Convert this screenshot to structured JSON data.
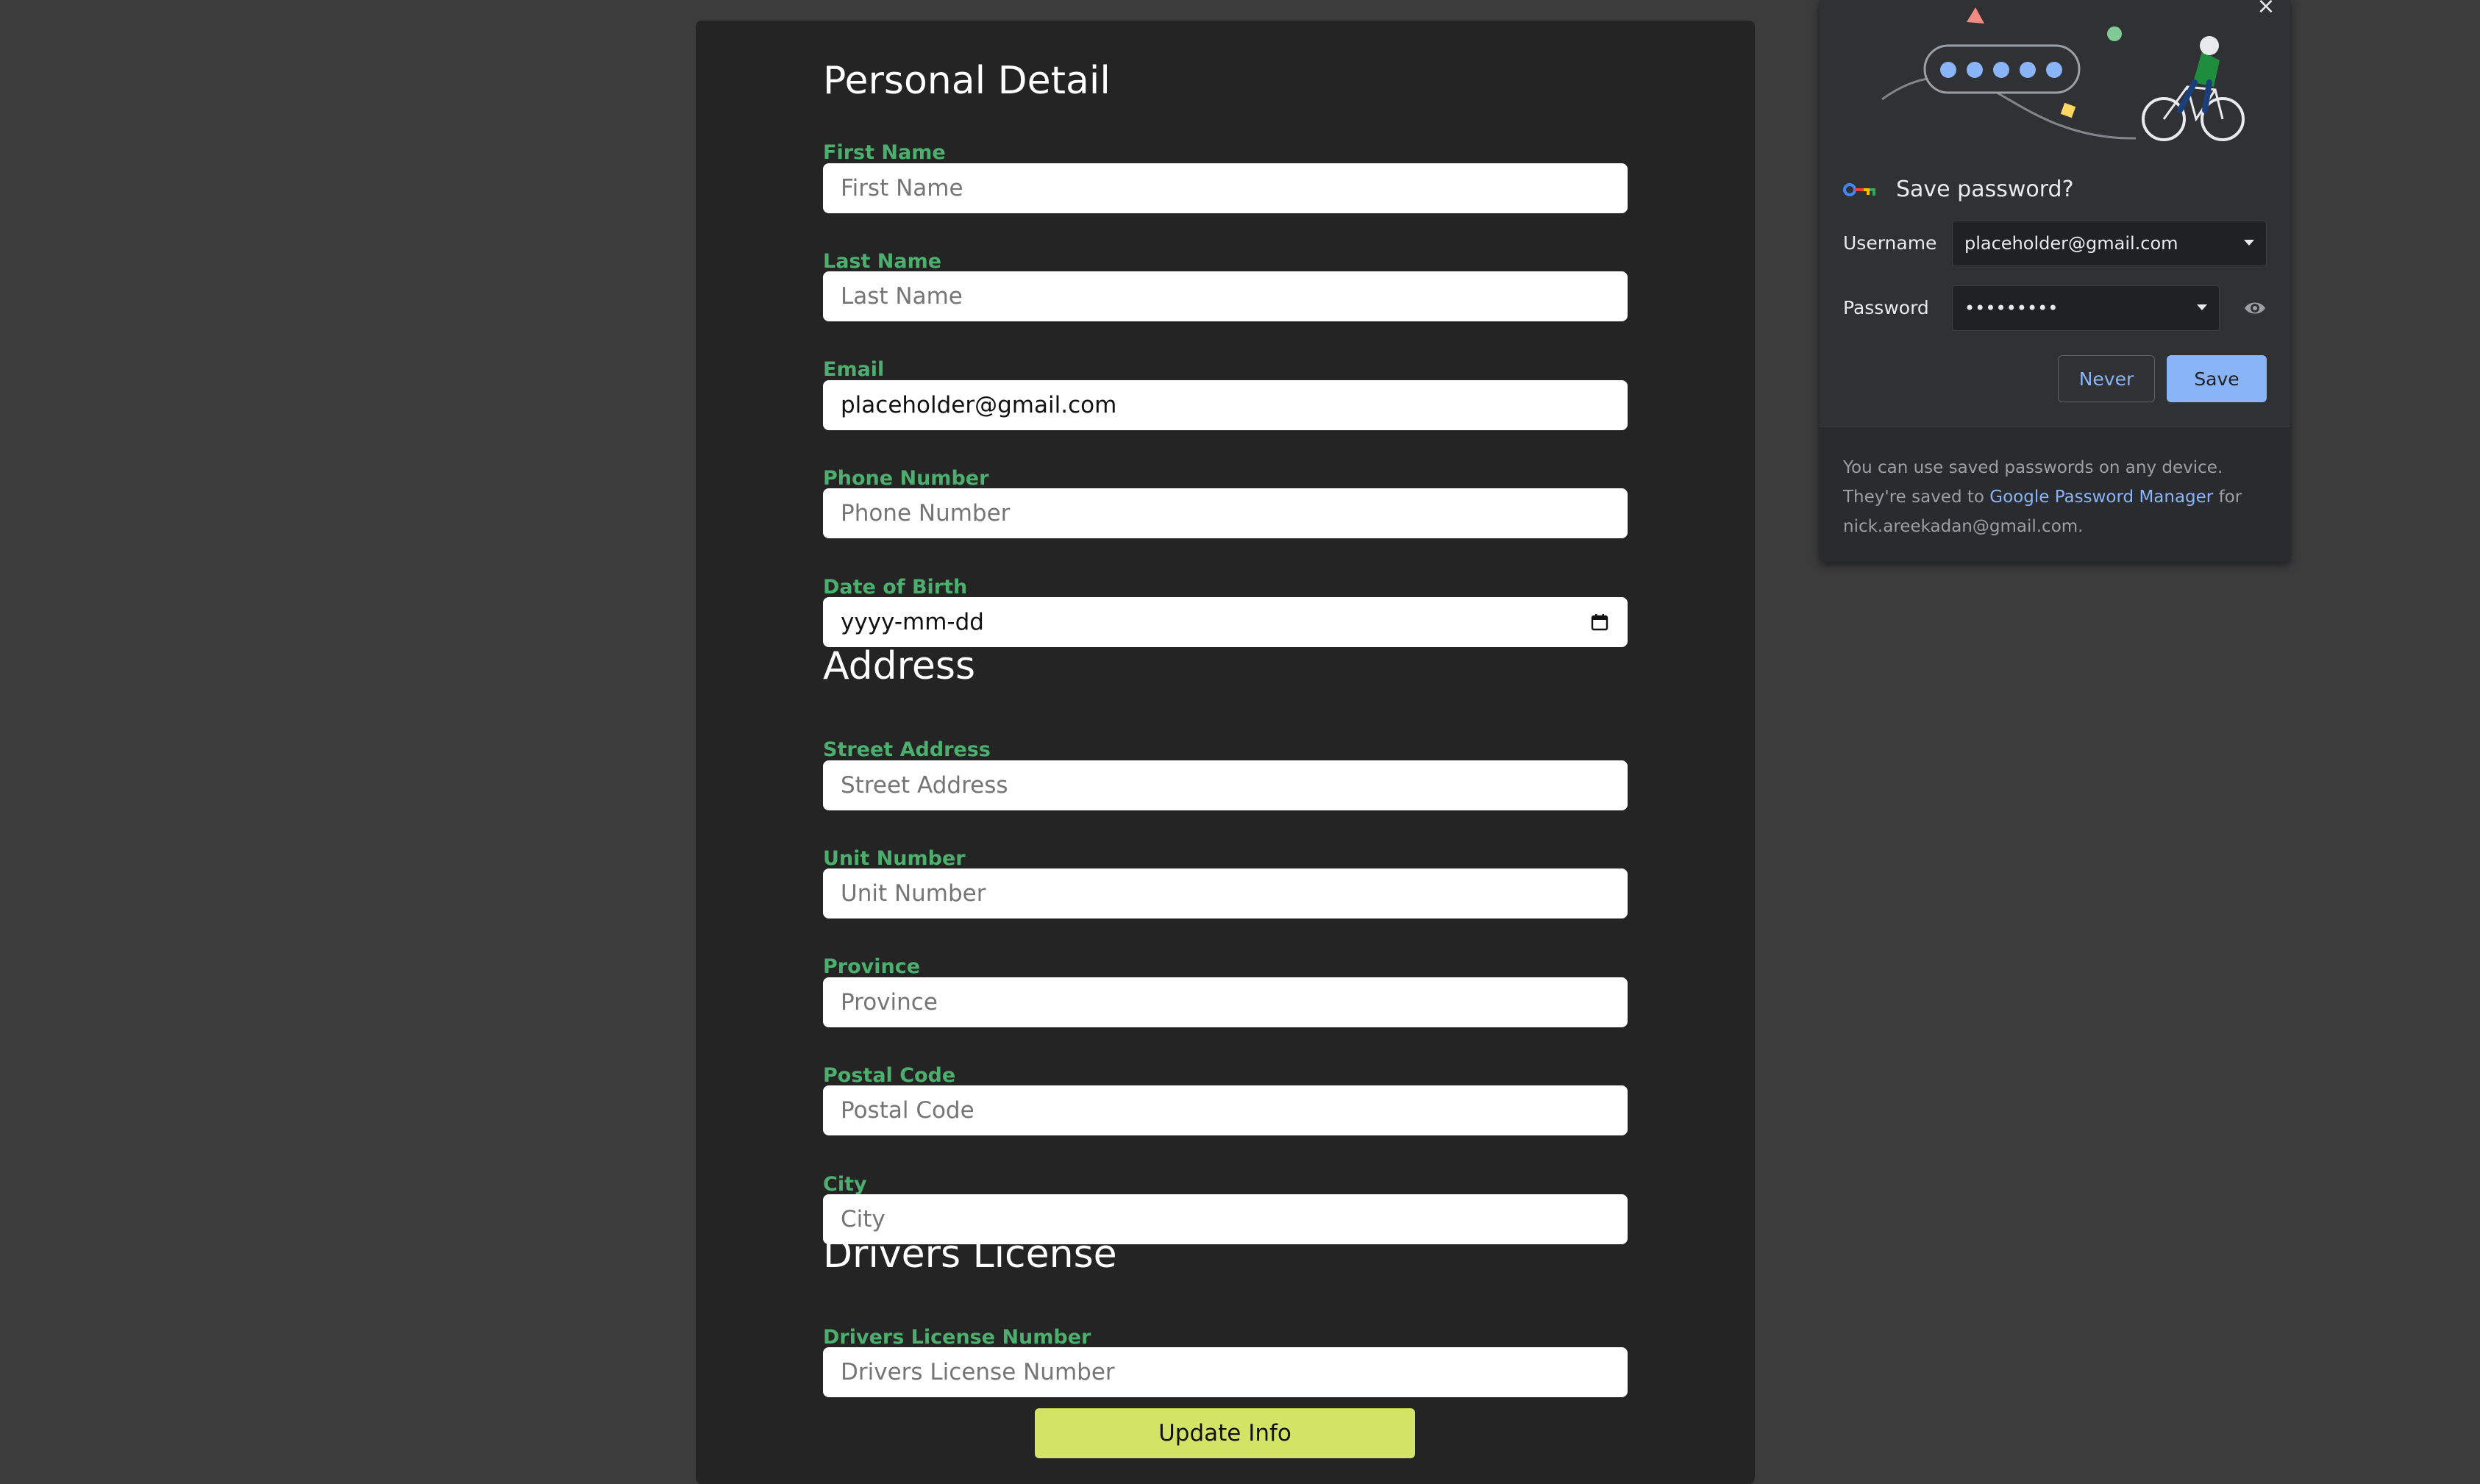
{
  "form": {
    "personal_title": "Personal Detail",
    "first_name": {
      "label": "First Name",
      "placeholder": "First Name"
    },
    "last_name": {
      "label": "Last Name",
      "placeholder": "Last Name"
    },
    "email": {
      "label": "Email",
      "value": "placeholder@gmail.com"
    },
    "phone": {
      "label": "Phone Number",
      "placeholder": "Phone Number"
    },
    "dob": {
      "label": "Date of Birth",
      "value": "yyyy-mm-dd"
    },
    "address_title": "Address",
    "street": {
      "label": "Street Address",
      "placeholder": "Street Address"
    },
    "unit": {
      "label": "Unit Number",
      "placeholder": "Unit Number"
    },
    "province": {
      "label": "Province",
      "placeholder": "Province"
    },
    "postal": {
      "label": "Postal Code",
      "placeholder": "Postal Code"
    },
    "city": {
      "label": "City",
      "placeholder": "City"
    },
    "license_title": "Drivers License",
    "license": {
      "label": "Drivers License Number",
      "placeholder": "Drivers License Number"
    },
    "submit_label": "Update Info"
  },
  "password_popup": {
    "title": "Save password?",
    "username_label": "Username",
    "username_value": "placeholder@gmail.com",
    "password_label": "Password",
    "password_value": "•••••••••",
    "never_label": "Never",
    "save_label": "Save",
    "footer_text_1": "You can use saved passwords on any device. They're saved to ",
    "footer_link": "Google Password Manager",
    "footer_text_2": " for nick.areekadan@gmail.com."
  },
  "colors": {
    "label_green": "#4caf6e",
    "button_lime": "#d2e466",
    "popup_accent": "#8ab4f8",
    "card_bg": "#242424",
    "page_bg": "#3c3c3c"
  },
  "icons": [
    "close-icon",
    "key-icon",
    "chevron-down-icon",
    "eye-icon",
    "calendar-icon"
  ]
}
